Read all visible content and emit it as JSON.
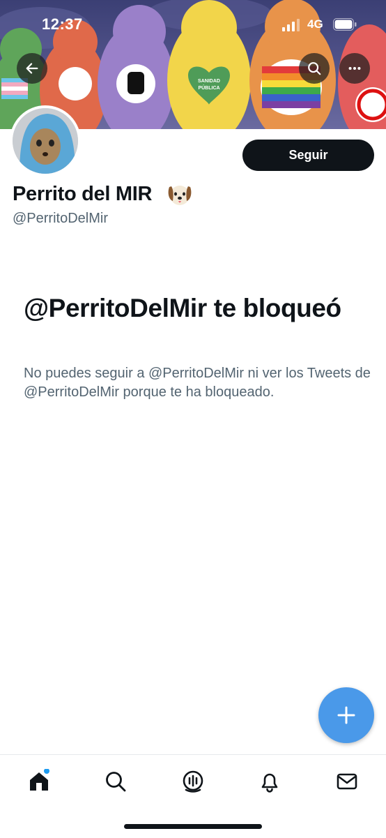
{
  "status_bar": {
    "time": "12:37",
    "network": "4G"
  },
  "banner": {
    "badge_text_line1": "SANIDAD",
    "badge_text_line2": "PÚBLICA"
  },
  "header_icons": {
    "back": "arrow-left-icon",
    "search": "search-icon",
    "more": "more-horizontal-icon"
  },
  "profile": {
    "display_name": "Perrito del MIR",
    "emoji": "dog-face-emoji",
    "handle": "@PerritoDelMir",
    "follow_label": "Seguir"
  },
  "blocked": {
    "title": "@PerritoDelMir te bloqueó",
    "body": "No puedes seguir a @PerritoDelMir ni ver los Tweets de @PerritoDelMir porque te ha bloqueado."
  },
  "fab": {
    "icon": "plus-icon"
  },
  "tabbar": {
    "tabs": [
      {
        "name": "home",
        "icon": "home-icon",
        "active": true,
        "has_dot": true
      },
      {
        "name": "search",
        "icon": "search-icon"
      },
      {
        "name": "spaces",
        "icon": "spaces-icon"
      },
      {
        "name": "notifications",
        "icon": "bell-icon"
      },
      {
        "name": "messages",
        "icon": "mail-icon"
      }
    ]
  },
  "colors": {
    "accent": "#4a99e9",
    "text": "#0f1419",
    "secondary": "#536471",
    "dot": "#1d9bf0"
  }
}
